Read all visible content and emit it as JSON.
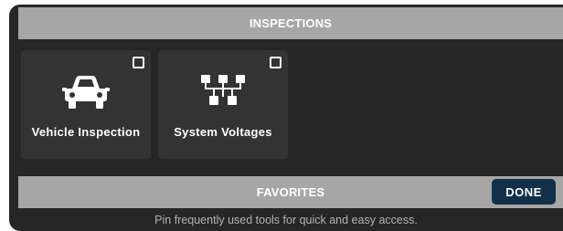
{
  "inspections": {
    "title": "INSPECTIONS",
    "tiles": [
      {
        "label": "Vehicle Inspection",
        "icon": "car-icon",
        "checked": false
      },
      {
        "label": "System Voltages",
        "icon": "network-tree-icon",
        "checked": false
      }
    ]
  },
  "favorites": {
    "title": "FAVORITES",
    "done_label": "DONE",
    "hint": "Pin frequently used tools for quick and easy access."
  },
  "colors": {
    "panel_bg": "#262626",
    "header_bar": "#a6a6a6",
    "tile_bg": "#333333",
    "done_button": "#12304a",
    "hint_text": "#b3b3b3"
  }
}
